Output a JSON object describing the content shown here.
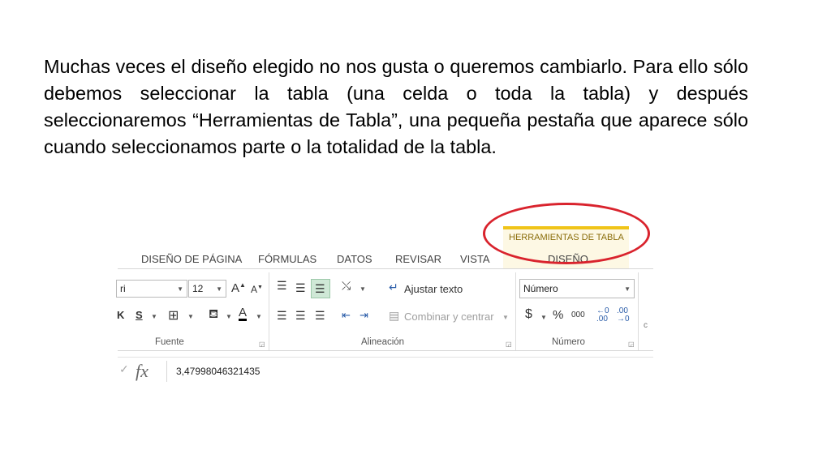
{
  "paragraph": "Muchas veces el diseño elegido no nos gusta o queremos cambiarlo. Para ello sólo debemos seleccionar la tabla (una celda o toda la tabla) y después seleccionaremos “Herramientas de Tabla”, una pequeña pestaña que aparece sólo cuando seleccionamos parte o la totalidad de la tabla.",
  "ribbon": {
    "tabs": [
      "DISEÑO DE PÁGINA",
      "FÓRMULAS",
      "DATOS",
      "REVISAR",
      "VISTA"
    ],
    "contextual_title": "HERRAMIENTAS DE TABLA",
    "contextual_tab": "DISEÑO",
    "font_name_partial": "ri",
    "font_size": "12",
    "strike_partial": "K",
    "underline_s": "S",
    "wrap_text": "Ajustar texto",
    "merge_center": "Combinar y centrar",
    "number_format": "Número",
    "currency": "$",
    "percent": "%",
    "thousands": "000",
    "groups": {
      "font": "Fuente",
      "alignment": "Alineación",
      "number": "Número"
    }
  },
  "formula_bar": {
    "fx": "fx",
    "value": "3,47998046321435"
  },
  "colors": {
    "ellipse": "#d9232d",
    "contextual_accent": "#f0c418"
  }
}
